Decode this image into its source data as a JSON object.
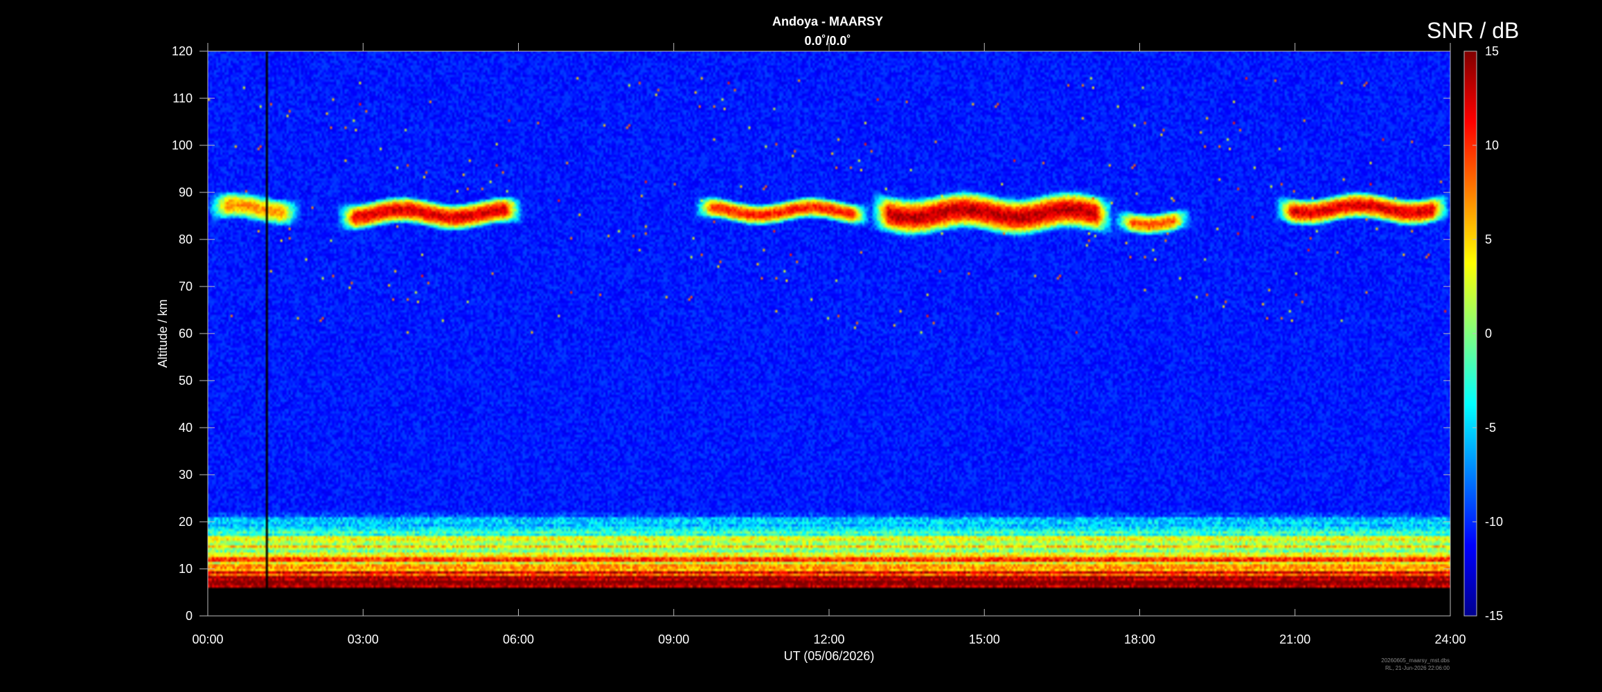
{
  "chart_data": {
    "type": "heatmap",
    "title": "Andoya - MAARSY",
    "subtitle": "0.0˚/0.0˚",
    "xlabel": "UT (05/06/2026)",
    "ylabel": "Altitude / km",
    "x_ticks": [
      "00:00",
      "03:00",
      "06:00",
      "09:00",
      "12:00",
      "15:00",
      "18:00",
      "21:00",
      "24:00"
    ],
    "xlim_hours": [
      0,
      24
    ],
    "ylim": [
      0,
      120
    ],
    "y_ticks": [
      0,
      10,
      20,
      30,
      40,
      50,
      60,
      70,
      80,
      90,
      100,
      110,
      120
    ],
    "colorbar": {
      "label": "SNR / dB",
      "range": [
        -15,
        15
      ],
      "ticks": [
        15,
        10,
        5,
        0,
        -5,
        -10,
        -15
      ],
      "colormap": "jet"
    },
    "data_gap": {
      "start_hour": 1.1,
      "end_hour": 1.16
    },
    "lowest_range_km": 6,
    "pmse_layers": [
      {
        "start_hour": 0.0,
        "end_hour": 1.8,
        "alt_top_km": 89.0,
        "alt_bottom_km": 84.0,
        "peak_snr_db": 8
      },
      {
        "start_hour": 2.5,
        "end_hour": 6.1,
        "alt_top_km": 88.0,
        "alt_bottom_km": 83.0,
        "peak_snr_db": 14
      },
      {
        "start_hour": 9.4,
        "end_hour": 12.8,
        "alt_top_km": 88.0,
        "alt_bottom_km": 84.0,
        "peak_snr_db": 12
      },
      {
        "start_hour": 12.8,
        "end_hour": 17.5,
        "alt_top_km": 89.0,
        "alt_bottom_km": 82.0,
        "peak_snr_db": 15
      },
      {
        "start_hour": 17.5,
        "end_hour": 19.0,
        "alt_top_km": 86.0,
        "alt_bottom_km": 82.0,
        "peak_snr_db": 10
      },
      {
        "start_hour": 20.6,
        "end_hour": 24.0,
        "alt_top_km": 89.0,
        "alt_bottom_km": 84.0,
        "peak_snr_db": 14
      }
    ],
    "background_snr_db": -12,
    "troposphere": {
      "alt_bottom_km": 6,
      "alt_top_km": 22,
      "peak_snr_db": 15
    }
  },
  "footer": {
    "file": "20260605_maarsy_mst.dbs",
    "stamp": "RL, 21-Jun-2026 22:06:00"
  }
}
